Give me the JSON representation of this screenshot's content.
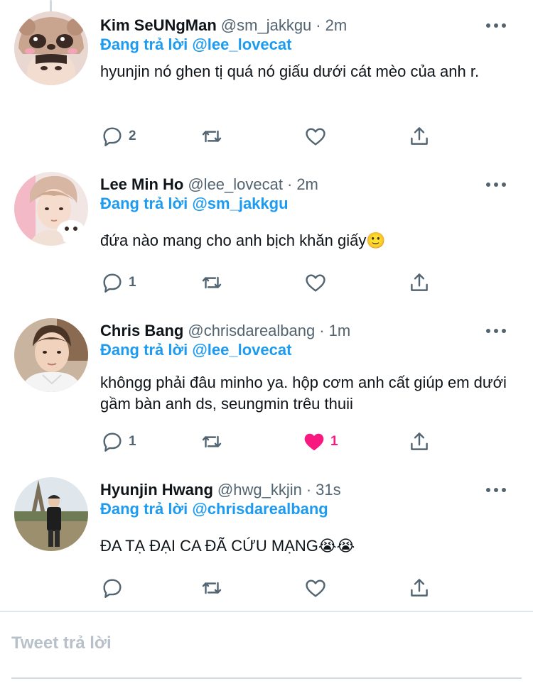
{
  "tweets": [
    {
      "name": "Kim SeUNgMan",
      "handle": "@sm_jakkgu",
      "time": "2m",
      "reply_prefix": "Đang trả lời",
      "reply_handle": "@lee_lovecat",
      "text": "hyunjin nó ghen tị quá nó giấu dưới cát mèo của anh r.",
      "reply_count": "2",
      "like_count": "",
      "liked": false
    },
    {
      "name": "Lee Min Ho",
      "handle": "@lee_lovecat",
      "time": "2m",
      "reply_prefix": "Đang trả lời",
      "reply_handle": "@sm_jakkgu",
      "text": "đứa nào mang cho anh bịch khăn giấy🙂",
      "reply_count": "1",
      "like_count": "",
      "liked": false
    },
    {
      "name": "Chris Bang",
      "handle": "@chrisdarealbang",
      "time": "1m",
      "reply_prefix": "Đang trả lời",
      "reply_handle": "@lee_lovecat",
      "text": "khôngg phải đâu minho ya. hộp cơm anh cất giúp em dưới gầm bàn anh ds, seungmin trêu thuii",
      "reply_count": "1",
      "like_count": "1",
      "liked": true
    },
    {
      "name": "Hyunjin Hwang",
      "handle": "@hwg_kkjin",
      "time": "31s",
      "reply_prefix": "Đang trả lời",
      "reply_handle": "@chrisdarealbang",
      "text": "ĐA TẠ ĐẠI CA ĐÃ CỨU MẠNG😭😭",
      "reply_count": "",
      "like_count": "",
      "liked": false
    }
  ],
  "separator": "·",
  "compose": {
    "placeholder": "Tweet trả lời"
  },
  "colors": {
    "accent": "#1d9bf0",
    "like": "#f91880",
    "muted": "#536471",
    "text": "#0f1419"
  },
  "icons": [
    "reply-icon",
    "retweet-icon",
    "like-icon",
    "share-icon",
    "more-icon"
  ]
}
